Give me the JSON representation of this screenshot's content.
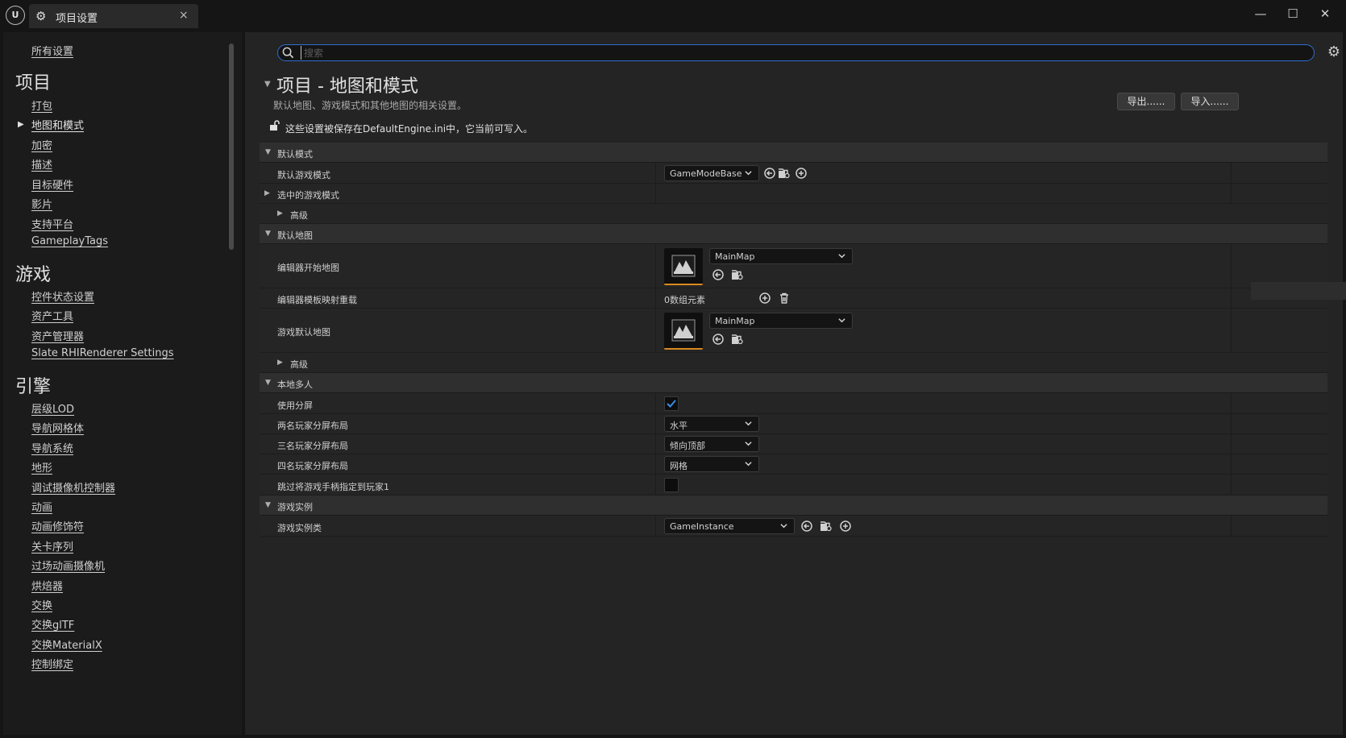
{
  "window": {
    "tab_title": "项目设置",
    "close_tab": "×",
    "minimize": "—",
    "maximize": "☐",
    "close": "✕"
  },
  "sidebar": {
    "all_settings": "所有设置",
    "sections": [
      {
        "heading": "项目",
        "items": [
          "打包",
          "地图和模式",
          "加密",
          "描述",
          "目标硬件",
          "影片",
          "支持平台",
          "GameplayTags"
        ]
      },
      {
        "heading": "游戏",
        "items": [
          "控件状态设置",
          "资产工具",
          "资产管理器",
          "Slate RHIRenderer Settings"
        ]
      },
      {
        "heading": "引擎",
        "items": [
          "层级LOD",
          "导航网格体",
          "导航系统",
          "地形",
          "调试摄像机控制器",
          "动画",
          "动画修饰符",
          "关卡序列",
          "过场动画摄像机",
          "烘焙器",
          "交换",
          "交换glTF",
          "交换MaterialX",
          "控制绑定"
        ]
      }
    ],
    "active_item": "地图和模式"
  },
  "search": {
    "placeholder": "搜索",
    "value": ""
  },
  "page": {
    "title": "项目 - 地图和模式",
    "description": "默认地图、游戏模式和其他地图的相关设置。",
    "export_label": "导出......",
    "import_label": "导入......",
    "save_note": "这些设置被保存在DefaultEngine.ini中，它当前可写入。"
  },
  "categories": {
    "default_modes": {
      "label": "默认模式",
      "default_game_mode_label": "默认游戏模式",
      "default_game_mode_value": "GameModeBase",
      "selected_game_mode_label": "选中的游戏模式",
      "advanced_label": "高级"
    },
    "default_maps": {
      "label": "默认地图",
      "editor_startup_map_label": "编辑器开始地图",
      "editor_startup_map_value": "MainMap",
      "editor_template_map_overrides_label": "编辑器模板映射重载",
      "editor_template_map_overrides_value": "0数组元素",
      "game_default_map_label": "游戏默认地图",
      "game_default_map_value": "MainMap",
      "advanced_label": "高级"
    },
    "local_multiplayer": {
      "label": "本地多人",
      "use_splitscreen_label": "使用分屏",
      "use_splitscreen_checked": true,
      "two_player_label": "两名玩家分屏布局",
      "two_player_value": "水平",
      "three_player_label": "三名玩家分屏布局",
      "three_player_value": "倾向顶部",
      "four_player_label": "四名玩家分屏布局",
      "four_player_value": "网格",
      "skip_gamepad_label": "跳过将游戏手柄指定到玩家1",
      "skip_gamepad_checked": false
    },
    "game_instance": {
      "label": "游戏实例",
      "game_instance_class_label": "游戏实例类",
      "game_instance_class_value": "GameInstance"
    }
  },
  "colors": {
    "accent_blue": "#2f6ed0",
    "thumbnail_underline": "#d88a1e",
    "checkbox_check": "#3a8ee6"
  }
}
